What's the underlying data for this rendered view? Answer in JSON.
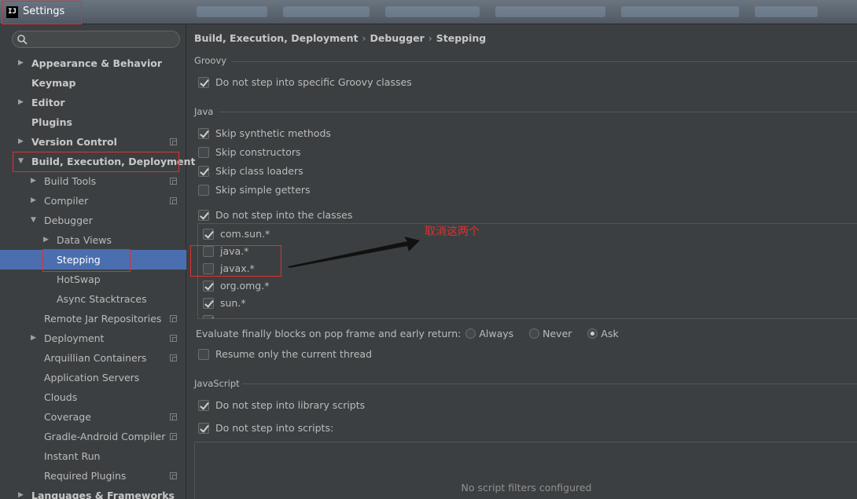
{
  "window": {
    "app_icon": "IJ",
    "title": "Settings"
  },
  "search": {
    "placeholder": ""
  },
  "sidebar": {
    "items": [
      {
        "label": "Appearance & Behavior"
      },
      {
        "label": "Keymap"
      },
      {
        "label": "Editor"
      },
      {
        "label": "Plugins"
      },
      {
        "label": "Version Control"
      },
      {
        "label": "Build, Execution, Deployment"
      },
      {
        "label": "Build Tools"
      },
      {
        "label": "Compiler"
      },
      {
        "label": "Debugger"
      },
      {
        "label": "Data Views"
      },
      {
        "label": "Stepping"
      },
      {
        "label": "HotSwap"
      },
      {
        "label": "Async Stacktraces"
      },
      {
        "label": "Remote Jar Repositories"
      },
      {
        "label": "Deployment"
      },
      {
        "label": "Arquillian Containers"
      },
      {
        "label": "Application Servers"
      },
      {
        "label": "Clouds"
      },
      {
        "label": "Coverage"
      },
      {
        "label": "Gradle-Android Compiler"
      },
      {
        "label": "Instant Run"
      },
      {
        "label": "Required Plugins"
      },
      {
        "label": "Languages & Frameworks"
      }
    ],
    "selected": "Stepping"
  },
  "breadcrumb": {
    "parts": [
      "Build, Execution, Deployment",
      "Debugger",
      "Stepping"
    ],
    "separator": "›"
  },
  "groovy": {
    "title": "Groovy",
    "no_step_groovy": {
      "label": "Do not step into specific Groovy classes",
      "checked": true
    }
  },
  "java": {
    "title": "Java",
    "skip_synthetic": {
      "label": "Skip synthetic methods",
      "checked": true
    },
    "skip_constructors": {
      "label": "Skip constructors",
      "checked": false
    },
    "skip_class_loaders": {
      "label": "Skip class loaders",
      "checked": true
    },
    "skip_simple_getters": {
      "label": "Skip simple getters",
      "checked": false
    },
    "no_step_classes": {
      "label": "Do not step into the classes",
      "checked": true
    },
    "classes": [
      {
        "label": "com.sun.*",
        "checked": true
      },
      {
        "label": "java.*",
        "checked": false
      },
      {
        "label": "javax.*",
        "checked": false
      },
      {
        "label": "org.omg.*",
        "checked": true
      },
      {
        "label": "sun.*",
        "checked": true
      }
    ],
    "annotation": "取消这两个",
    "finally": {
      "label": "Evaluate finally blocks on pop frame and early return:",
      "options": [
        {
          "label": "Always",
          "selected": false
        },
        {
          "label": "Never",
          "selected": false
        },
        {
          "label": "Ask",
          "selected": true
        }
      ]
    },
    "resume_current_thread": {
      "label": "Resume only the current thread",
      "checked": false
    }
  },
  "javascript": {
    "title": "JavaScript",
    "no_step_library": {
      "label": "Do not step into library scripts",
      "checked": true
    },
    "no_step_scripts": {
      "label": "Do not step into scripts:",
      "checked": true
    },
    "empty_text": "No script filters configured"
  },
  "colors": {
    "background": "#3c3f41",
    "selection": "#4b6eaf",
    "annotation_red": "#e03030"
  }
}
